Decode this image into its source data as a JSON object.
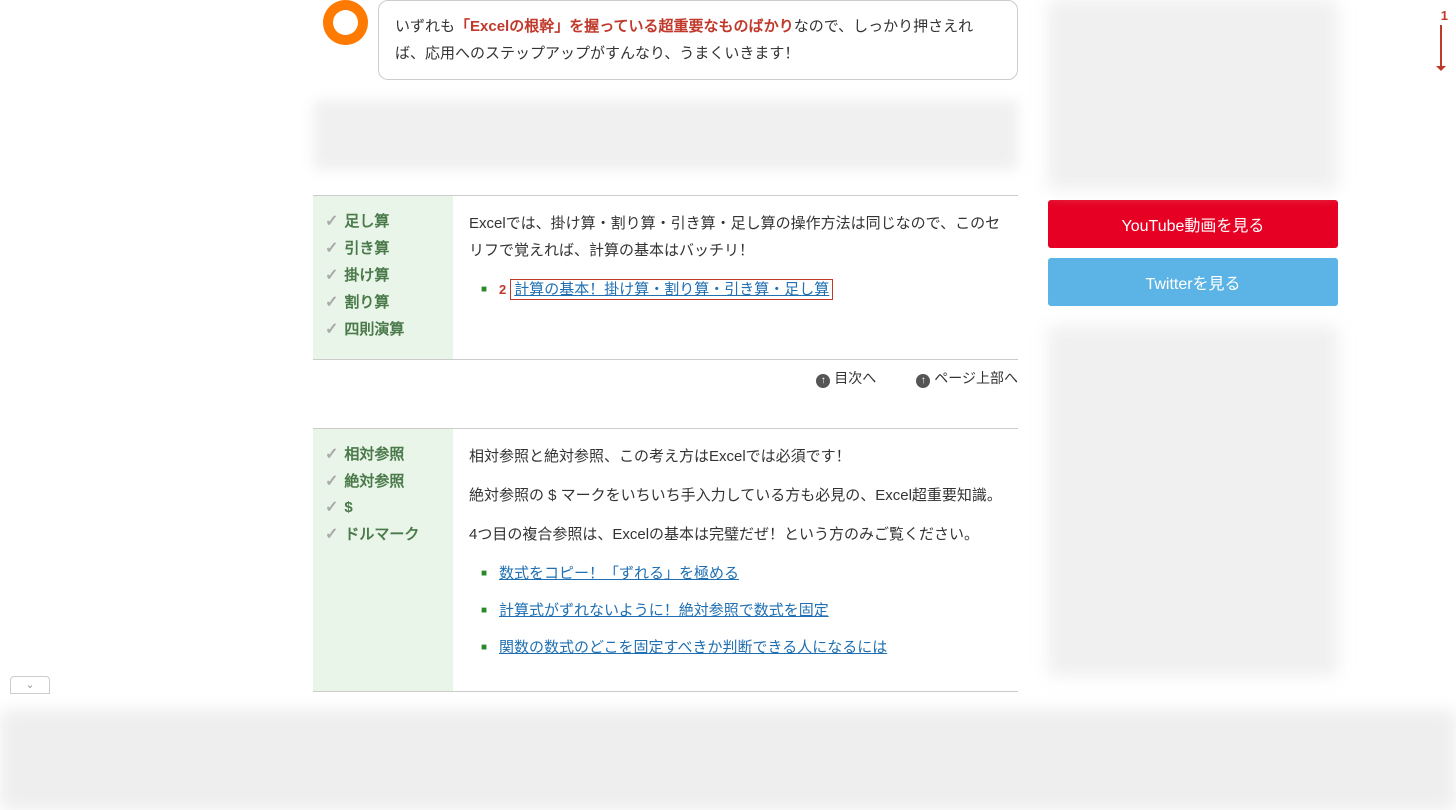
{
  "intro": {
    "pre": "いずれも",
    "red": "「Excelの根幹」を握っている超重要なものばかり",
    "post": "なので、しっかり押さえれば、応用へのステップアップがすんなり、うまくいきます！"
  },
  "section1": {
    "tags": [
      "足し算",
      "引き算",
      "掛け算",
      "割り算",
      "四則演算"
    ],
    "text": "Excelでは、掛け算・割り算・引き算・足し算の操作方法は同じなので、このセリフで覚えれば、計算の基本はバッチリ！",
    "link": "計算の基本！掛け算・割り算・引き算・足し算",
    "num": "2"
  },
  "nav": {
    "toc": "目次へ",
    "top": "ページ上部へ"
  },
  "section2": {
    "tags": [
      "相対参照",
      "絶対参照",
      "$",
      "ドルマーク"
    ],
    "p1": "相対参照と絶対参照、この考え方はExcelでは必須です！",
    "p2": "絶対参照の $ マークをいちいち手入力している方も必見の、Excel超重要知識。",
    "p3": "4つ目の複合参照は、Excelの基本は完璧だぜ！という方のみご覧ください。",
    "links": [
      "数式をコピー！「ずれる」を極める",
      "計算式がずれないように！絶対参照で数式を固定",
      "関数の数式のどこを固定すべきか判断できる人になるには"
    ]
  },
  "sidebar": {
    "youtube": "YouTube動画を見る",
    "twitter": "Twitterを見る"
  },
  "marker": "1"
}
